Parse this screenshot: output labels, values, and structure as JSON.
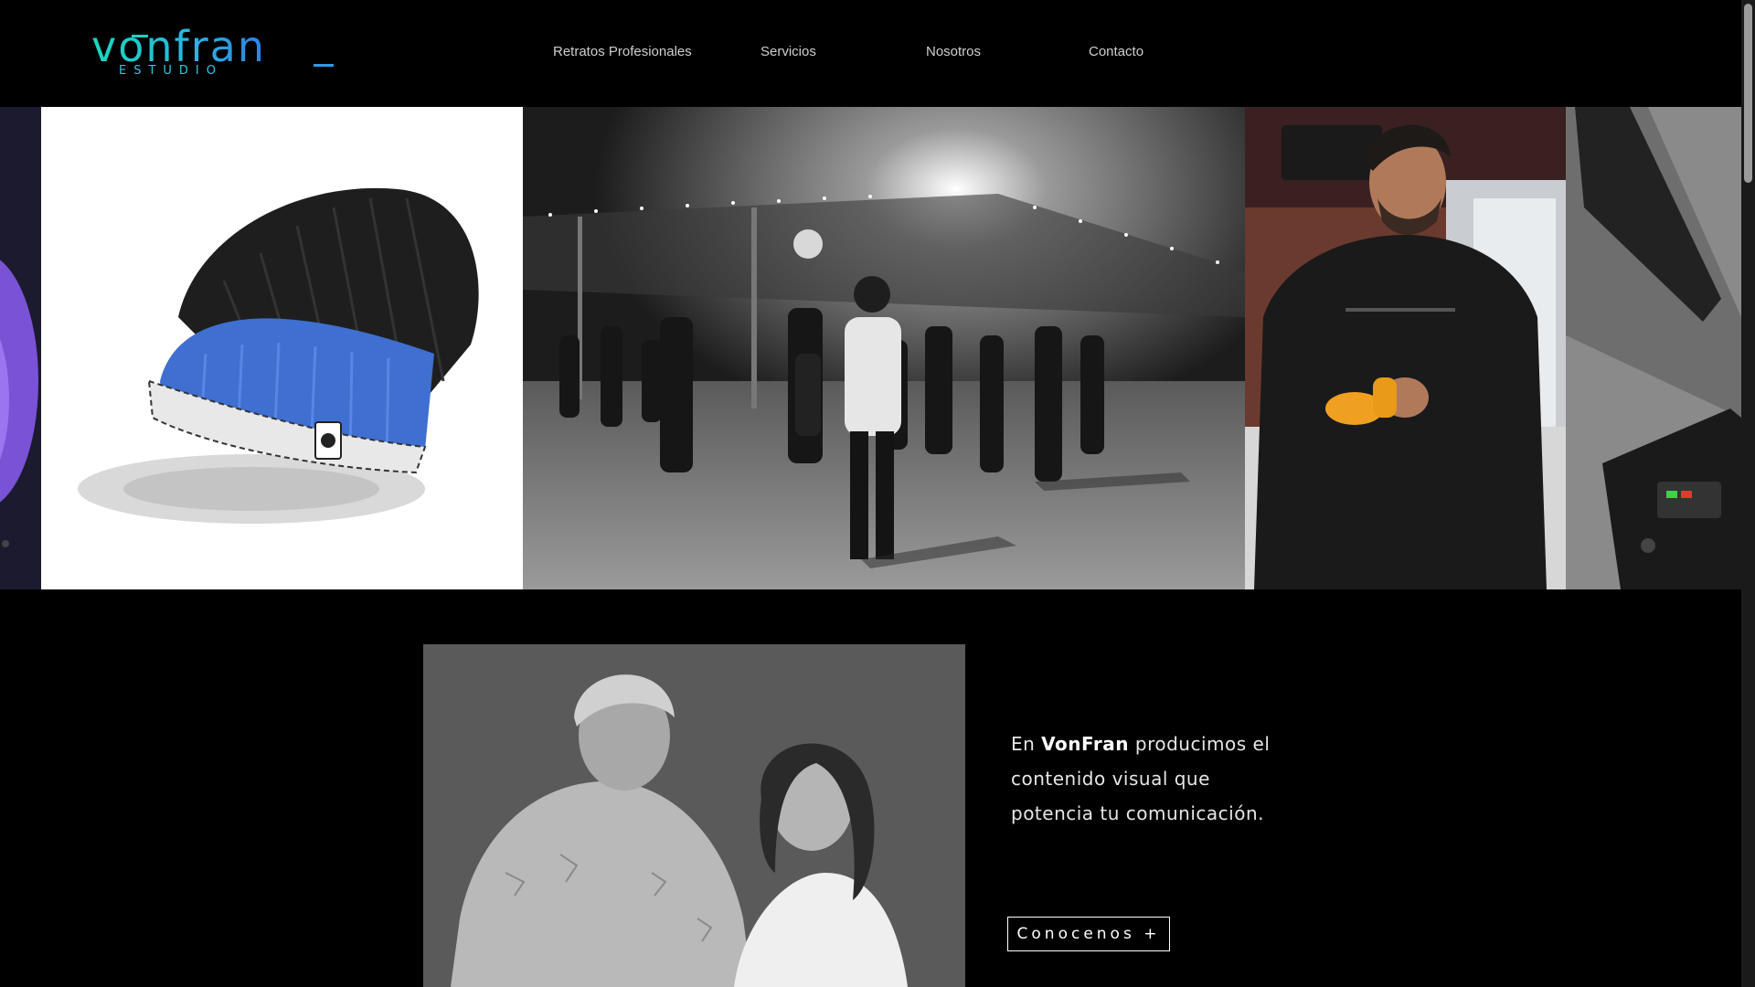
{
  "brand": {
    "logo_word": "vonfran",
    "logo_sub": "ESTUDIO"
  },
  "nav": {
    "items": [
      {
        "label": "Retratos Profesionales"
      },
      {
        "label": "Servicios"
      },
      {
        "label": "Nosotros"
      },
      {
        "label": "Contacto"
      }
    ]
  },
  "about": {
    "text_before": "En ",
    "brand_bold": "VonFran",
    "text_after": " producimos el contenido visual que potencia tu comunicación.",
    "cta_label": "Conocenos +"
  },
  "colors": {
    "accent_teal": "#19d8b8",
    "accent_blue": "#2f7fe0",
    "hat_blue": "#3f6fd0",
    "wrap_orange": "#f0a020"
  }
}
